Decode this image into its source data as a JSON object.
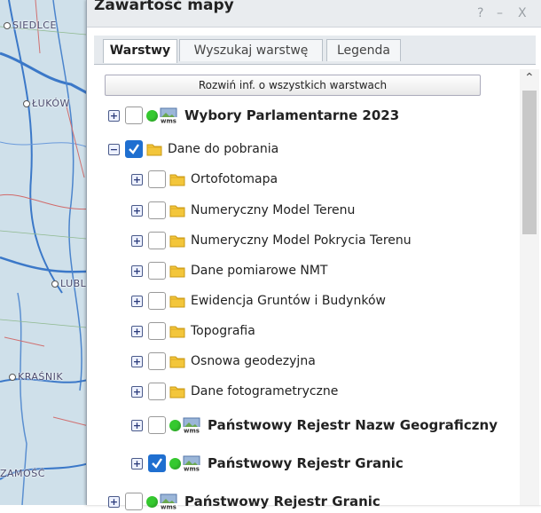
{
  "map": {
    "cities": [
      "SIEDLCE",
      "ŁUKÓW",
      "LUBLIN",
      "KRAŚNIK",
      "ZAMOŚĆ"
    ]
  },
  "panel": {
    "title": "Zawartość mapy",
    "help": "?",
    "minimize": "–",
    "close": "X",
    "tabs": [
      "Warstwy",
      "Wyszukaj warstwę",
      "Legenda"
    ],
    "expand_all_label": "Rozwiń inf. o wszystkich warstwach",
    "layers": [
      {
        "label": "Wybory Parlamentarne 2023",
        "checked": false,
        "type": "wms"
      },
      {
        "label": "Dane do pobrania",
        "checked": true,
        "type": "folder",
        "expanded": true
      },
      {
        "label": "Ortofotomapa",
        "checked": false,
        "type": "folder"
      },
      {
        "label": "Numeryczny Model Terenu",
        "checked": false,
        "type": "folder"
      },
      {
        "label": "Numeryczny Model Pokrycia Terenu",
        "checked": false,
        "type": "folder"
      },
      {
        "label": "Dane pomiarowe NMT",
        "checked": false,
        "type": "folder"
      },
      {
        "label": "Ewidencja Gruntów i Budynków",
        "checked": false,
        "type": "folder"
      },
      {
        "label": "Topografia",
        "checked": false,
        "type": "folder"
      },
      {
        "label": "Osnowa geodezyjna",
        "checked": false,
        "type": "folder"
      },
      {
        "label": "Dane fotogrametryczne",
        "checked": false,
        "type": "folder"
      },
      {
        "label": "Państwowy Rejestr Nazw Geograficzny",
        "checked": false,
        "type": "wms"
      },
      {
        "label": "Państwowy Rejestr Granic",
        "checked": true,
        "type": "wms"
      },
      {
        "label": "Państwowy Rejestr Granic",
        "checked": false,
        "type": "wms"
      }
    ]
  },
  "colors": {
    "accent": "#1f6fd0",
    "status_green": "#35c92f",
    "folder_yellow": "#f3c63b"
  }
}
